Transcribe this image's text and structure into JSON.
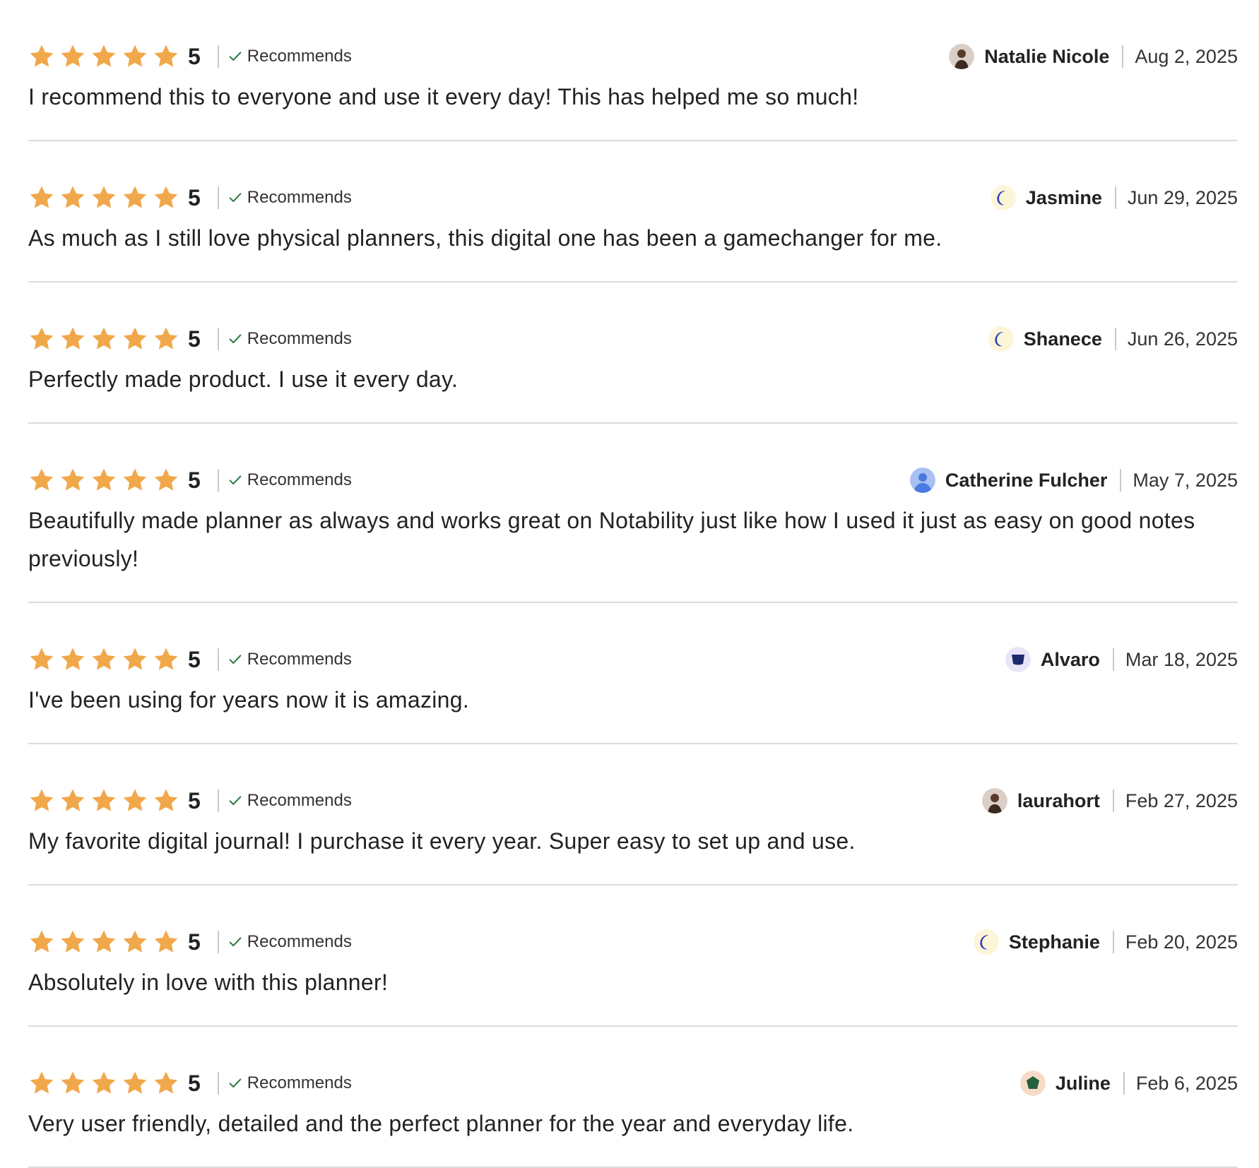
{
  "colors": {
    "star": "#f0a84b",
    "check": "#2f7a3f",
    "divider": "#dcdcdc"
  },
  "reviews": [
    {
      "rating": 5,
      "score_label": "5",
      "recommends_label": "Recommends",
      "author": "Natalie Nicole",
      "avatar_icon": "photo-avatar-icon",
      "date": "Aug 2, 2025",
      "text": "I recommend this to everyone and use it every day! This has helped me so much!"
    },
    {
      "rating": 5,
      "score_label": "5",
      "recommends_label": "Recommends",
      "author": "Jasmine",
      "avatar_icon": "crescent-avatar-icon",
      "date": "Jun 29, 2025",
      "text": "As much as I still love physical planners, this digital one has been a gamechanger for me."
    },
    {
      "rating": 5,
      "score_label": "5",
      "recommends_label": "Recommends",
      "author": "Shanece",
      "avatar_icon": "crescent-avatar-icon",
      "date": "Jun 26, 2025",
      "text": "Perfectly made product. I use it every day."
    },
    {
      "rating": 5,
      "score_label": "5",
      "recommends_label": "Recommends",
      "author": "Catherine Fulcher",
      "avatar_icon": "default-user-avatar-icon",
      "date": "May 7, 2025",
      "text": "Beautifully made planner as always and works great on Notability just like how I used it just as easy on good notes previously!"
    },
    {
      "rating": 5,
      "score_label": "5",
      "recommends_label": "Recommends",
      "author": "Alvaro",
      "avatar_icon": "shield-avatar-icon",
      "date": "Mar 18, 2025",
      "text": "I've been using for years now it is amazing."
    },
    {
      "rating": 5,
      "score_label": "5",
      "recommends_label": "Recommends",
      "author": "laurahort",
      "avatar_icon": "photo-avatar-icon",
      "date": "Feb 27, 2025",
      "text": "My favorite digital journal! I purchase it every year. Super easy to set up and use."
    },
    {
      "rating": 5,
      "score_label": "5",
      "recommends_label": "Recommends",
      "author": "Stephanie",
      "avatar_icon": "crescent-avatar-icon",
      "date": "Feb 20, 2025",
      "text": "Absolutely in love with this planner!"
    },
    {
      "rating": 5,
      "score_label": "5",
      "recommends_label": "Recommends",
      "author": "Juline",
      "avatar_icon": "pentagon-avatar-icon",
      "date": "Feb 6, 2025",
      "text": "Very user friendly, detailed and the perfect planner for the year and everyday life."
    }
  ]
}
